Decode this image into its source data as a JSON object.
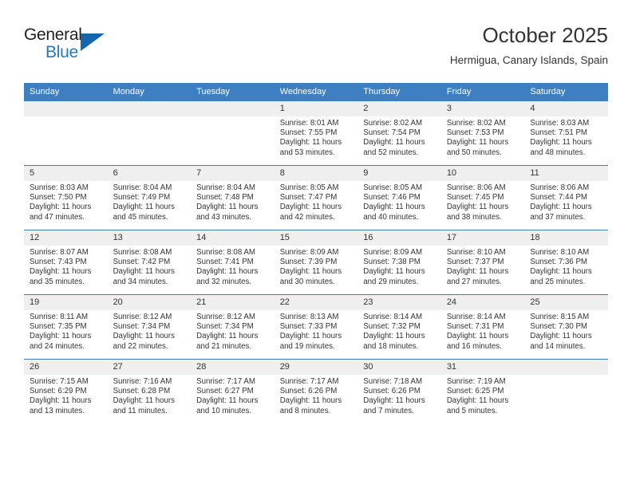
{
  "brand": {
    "name_top": "General",
    "name_bottom": "Blue",
    "accent_color": "#1566ad",
    "text_color": "#231f20"
  },
  "header": {
    "month_title": "October 2025",
    "location": "Hermigua, Canary Islands, Spain"
  },
  "theme": {
    "header_blue": "#3e7fc1",
    "daynum_band": "#efefef",
    "text": "#333333"
  },
  "calendar": {
    "weekday_headers": [
      "Sunday",
      "Monday",
      "Tuesday",
      "Wednesday",
      "Thursday",
      "Friday",
      "Saturday"
    ],
    "weeks": [
      [
        {
          "day": "",
          "sunrise": "",
          "sunset": "",
          "daylight_line1": "",
          "daylight_line2": ""
        },
        {
          "day": "",
          "sunrise": "",
          "sunset": "",
          "daylight_line1": "",
          "daylight_line2": ""
        },
        {
          "day": "",
          "sunrise": "",
          "sunset": "",
          "daylight_line1": "",
          "daylight_line2": ""
        },
        {
          "day": "1",
          "sunrise": "Sunrise: 8:01 AM",
          "sunset": "Sunset: 7:55 PM",
          "daylight_line1": "Daylight: 11 hours",
          "daylight_line2": "and 53 minutes."
        },
        {
          "day": "2",
          "sunrise": "Sunrise: 8:02 AM",
          "sunset": "Sunset: 7:54 PM",
          "daylight_line1": "Daylight: 11 hours",
          "daylight_line2": "and 52 minutes."
        },
        {
          "day": "3",
          "sunrise": "Sunrise: 8:02 AM",
          "sunset": "Sunset: 7:53 PM",
          "daylight_line1": "Daylight: 11 hours",
          "daylight_line2": "and 50 minutes."
        },
        {
          "day": "4",
          "sunrise": "Sunrise: 8:03 AM",
          "sunset": "Sunset: 7:51 PM",
          "daylight_line1": "Daylight: 11 hours",
          "daylight_line2": "and 48 minutes."
        }
      ],
      [
        {
          "day": "5",
          "sunrise": "Sunrise: 8:03 AM",
          "sunset": "Sunset: 7:50 PM",
          "daylight_line1": "Daylight: 11 hours",
          "daylight_line2": "and 47 minutes."
        },
        {
          "day": "6",
          "sunrise": "Sunrise: 8:04 AM",
          "sunset": "Sunset: 7:49 PM",
          "daylight_line1": "Daylight: 11 hours",
          "daylight_line2": "and 45 minutes."
        },
        {
          "day": "7",
          "sunrise": "Sunrise: 8:04 AM",
          "sunset": "Sunset: 7:48 PM",
          "daylight_line1": "Daylight: 11 hours",
          "daylight_line2": "and 43 minutes."
        },
        {
          "day": "8",
          "sunrise": "Sunrise: 8:05 AM",
          "sunset": "Sunset: 7:47 PM",
          "daylight_line1": "Daylight: 11 hours",
          "daylight_line2": "and 42 minutes."
        },
        {
          "day": "9",
          "sunrise": "Sunrise: 8:05 AM",
          "sunset": "Sunset: 7:46 PM",
          "daylight_line1": "Daylight: 11 hours",
          "daylight_line2": "and 40 minutes."
        },
        {
          "day": "10",
          "sunrise": "Sunrise: 8:06 AM",
          "sunset": "Sunset: 7:45 PM",
          "daylight_line1": "Daylight: 11 hours",
          "daylight_line2": "and 38 minutes."
        },
        {
          "day": "11",
          "sunrise": "Sunrise: 8:06 AM",
          "sunset": "Sunset: 7:44 PM",
          "daylight_line1": "Daylight: 11 hours",
          "daylight_line2": "and 37 minutes."
        }
      ],
      [
        {
          "day": "12",
          "sunrise": "Sunrise: 8:07 AM",
          "sunset": "Sunset: 7:43 PM",
          "daylight_line1": "Daylight: 11 hours",
          "daylight_line2": "and 35 minutes."
        },
        {
          "day": "13",
          "sunrise": "Sunrise: 8:08 AM",
          "sunset": "Sunset: 7:42 PM",
          "daylight_line1": "Daylight: 11 hours",
          "daylight_line2": "and 34 minutes."
        },
        {
          "day": "14",
          "sunrise": "Sunrise: 8:08 AM",
          "sunset": "Sunset: 7:41 PM",
          "daylight_line1": "Daylight: 11 hours",
          "daylight_line2": "and 32 minutes."
        },
        {
          "day": "15",
          "sunrise": "Sunrise: 8:09 AM",
          "sunset": "Sunset: 7:39 PM",
          "daylight_line1": "Daylight: 11 hours",
          "daylight_line2": "and 30 minutes."
        },
        {
          "day": "16",
          "sunrise": "Sunrise: 8:09 AM",
          "sunset": "Sunset: 7:38 PM",
          "daylight_line1": "Daylight: 11 hours",
          "daylight_line2": "and 29 minutes."
        },
        {
          "day": "17",
          "sunrise": "Sunrise: 8:10 AM",
          "sunset": "Sunset: 7:37 PM",
          "daylight_line1": "Daylight: 11 hours",
          "daylight_line2": "and 27 minutes."
        },
        {
          "day": "18",
          "sunrise": "Sunrise: 8:10 AM",
          "sunset": "Sunset: 7:36 PM",
          "daylight_line1": "Daylight: 11 hours",
          "daylight_line2": "and 25 minutes."
        }
      ],
      [
        {
          "day": "19",
          "sunrise": "Sunrise: 8:11 AM",
          "sunset": "Sunset: 7:35 PM",
          "daylight_line1": "Daylight: 11 hours",
          "daylight_line2": "and 24 minutes."
        },
        {
          "day": "20",
          "sunrise": "Sunrise: 8:12 AM",
          "sunset": "Sunset: 7:34 PM",
          "daylight_line1": "Daylight: 11 hours",
          "daylight_line2": "and 22 minutes."
        },
        {
          "day": "21",
          "sunrise": "Sunrise: 8:12 AM",
          "sunset": "Sunset: 7:34 PM",
          "daylight_line1": "Daylight: 11 hours",
          "daylight_line2": "and 21 minutes."
        },
        {
          "day": "22",
          "sunrise": "Sunrise: 8:13 AM",
          "sunset": "Sunset: 7:33 PM",
          "daylight_line1": "Daylight: 11 hours",
          "daylight_line2": "and 19 minutes."
        },
        {
          "day": "23",
          "sunrise": "Sunrise: 8:14 AM",
          "sunset": "Sunset: 7:32 PM",
          "daylight_line1": "Daylight: 11 hours",
          "daylight_line2": "and 18 minutes."
        },
        {
          "day": "24",
          "sunrise": "Sunrise: 8:14 AM",
          "sunset": "Sunset: 7:31 PM",
          "daylight_line1": "Daylight: 11 hours",
          "daylight_line2": "and 16 minutes."
        },
        {
          "day": "25",
          "sunrise": "Sunrise: 8:15 AM",
          "sunset": "Sunset: 7:30 PM",
          "daylight_line1": "Daylight: 11 hours",
          "daylight_line2": "and 14 minutes."
        }
      ],
      [
        {
          "day": "26",
          "sunrise": "Sunrise: 7:15 AM",
          "sunset": "Sunset: 6:29 PM",
          "daylight_line1": "Daylight: 11 hours",
          "daylight_line2": "and 13 minutes."
        },
        {
          "day": "27",
          "sunrise": "Sunrise: 7:16 AM",
          "sunset": "Sunset: 6:28 PM",
          "daylight_line1": "Daylight: 11 hours",
          "daylight_line2": "and 11 minutes."
        },
        {
          "day": "28",
          "sunrise": "Sunrise: 7:17 AM",
          "sunset": "Sunset: 6:27 PM",
          "daylight_line1": "Daylight: 11 hours",
          "daylight_line2": "and 10 minutes."
        },
        {
          "day": "29",
          "sunrise": "Sunrise: 7:17 AM",
          "sunset": "Sunset: 6:26 PM",
          "daylight_line1": "Daylight: 11 hours",
          "daylight_line2": "and 8 minutes."
        },
        {
          "day": "30",
          "sunrise": "Sunrise: 7:18 AM",
          "sunset": "Sunset: 6:26 PM",
          "daylight_line1": "Daylight: 11 hours",
          "daylight_line2": "and 7 minutes."
        },
        {
          "day": "31",
          "sunrise": "Sunrise: 7:19 AM",
          "sunset": "Sunset: 6:25 PM",
          "daylight_line1": "Daylight: 11 hours",
          "daylight_line2": "and 5 minutes."
        },
        {
          "day": "",
          "sunrise": "",
          "sunset": "",
          "daylight_line1": "",
          "daylight_line2": ""
        }
      ]
    ]
  }
}
